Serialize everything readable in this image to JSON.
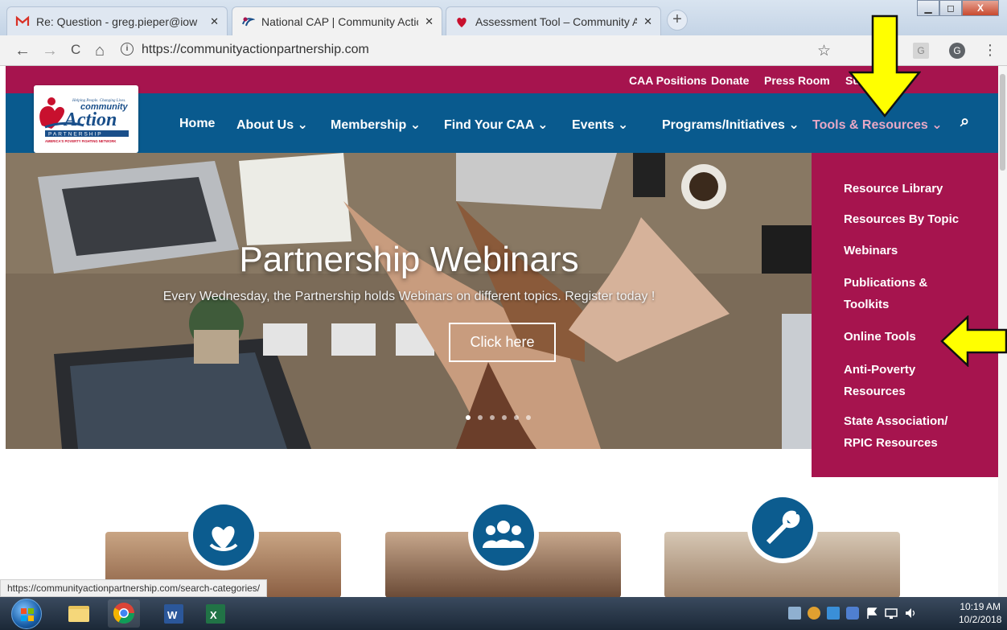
{
  "browser": {
    "tabs": [
      {
        "title": "Re: Question - greg.pieper@iow",
        "close": "✕"
      },
      {
        "title": "National CAP | Community Actio",
        "close": "✕"
      },
      {
        "title": "Assessment Tool – Community A",
        "close": "✕"
      }
    ],
    "new_tab": "+",
    "window_buttons": {
      "minimize": "▁",
      "maximize": "◻",
      "close": "X"
    },
    "nav": {
      "back": "←",
      "forward": "→",
      "reload": "C",
      "home": "⌂",
      "info": "i"
    },
    "url": "https://communityactionpartnership.com",
    "star": "☆",
    "profile_initial": "G",
    "ext_initial": "G",
    "menu": "⋮"
  },
  "site": {
    "utility_links": [
      "CAA Positions",
      "Donate",
      "Press Room",
      "Subscribe"
    ],
    "logo": {
      "tagline": "Helping People. Changing Lives.",
      "line1": "community",
      "line2": "Action",
      "line3": "PARTNERSHIP",
      "line4": "AMERICA'S POVERTY FIGHTING NETWORK"
    },
    "nav": [
      {
        "label": "Home"
      },
      {
        "label": "About Us ⌄"
      },
      {
        "label": "Membership ⌄"
      },
      {
        "label": "Find Your CAA ⌄"
      },
      {
        "label": "Events ⌄"
      },
      {
        "label": "Programs/Initiatives ⌄"
      },
      {
        "label": "Tools & Resources ⌄"
      }
    ],
    "search_icon": "⌕",
    "hero": {
      "title": "Partnership Webinars",
      "subtitle": "Every Wednesday, the Partnership holds Webinars on different topics. Register today !",
      "button": "Click here",
      "slides": 6,
      "active_slide": 0
    },
    "dropdown": [
      {
        "line1": "Resource Library"
      },
      {
        "line1": "Resources By Topic"
      },
      {
        "line1": "Webinars"
      },
      {
        "line1": "Publications &",
        "line2": "Toolkits"
      },
      {
        "line1": "Online Tools"
      },
      {
        "line1": "Anti-Poverty",
        "line2": "Resources"
      },
      {
        "line1": "State Association/",
        "line2": "RPIC Resources"
      }
    ]
  },
  "status_url": "https://communityactionpartnership.com/search-categories/",
  "taskbar": {
    "clock_time": "10:19 AM",
    "clock_date": "10/2/2018"
  },
  "colors": {
    "magenta": "#a6144e",
    "navy": "#095a8e",
    "arrow": "#ffff00"
  }
}
